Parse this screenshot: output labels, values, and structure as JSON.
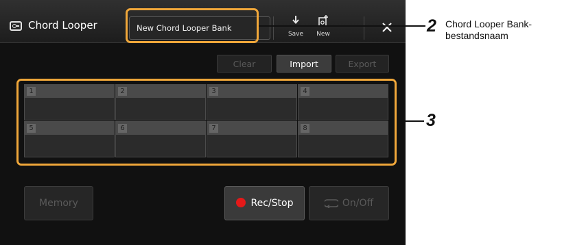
{
  "app": {
    "title": "Chord Looper"
  },
  "bank": {
    "name": "New Chord Looper Bank"
  },
  "toolbar": {
    "save_label": "Save",
    "new_label": "New"
  },
  "actions": {
    "clear_label": "Clear",
    "import_label": "Import",
    "export_label": "Export"
  },
  "pads": [
    {
      "number": "1"
    },
    {
      "number": "2"
    },
    {
      "number": "3"
    },
    {
      "number": "4"
    },
    {
      "number": "5"
    },
    {
      "number": "6"
    },
    {
      "number": "7"
    },
    {
      "number": "8"
    }
  ],
  "controls": {
    "memory_label": "Memory",
    "recstop_label": "Rec/Stop",
    "onoff_label": "On/Off"
  },
  "annotations": {
    "callout_2_number": "2",
    "callout_2_text": "Chord Looper Bank-bestandsnaam",
    "callout_3_number": "3"
  },
  "colors": {
    "highlight": "#f0a73a",
    "record": "#e51919",
    "panel": "#111111"
  }
}
